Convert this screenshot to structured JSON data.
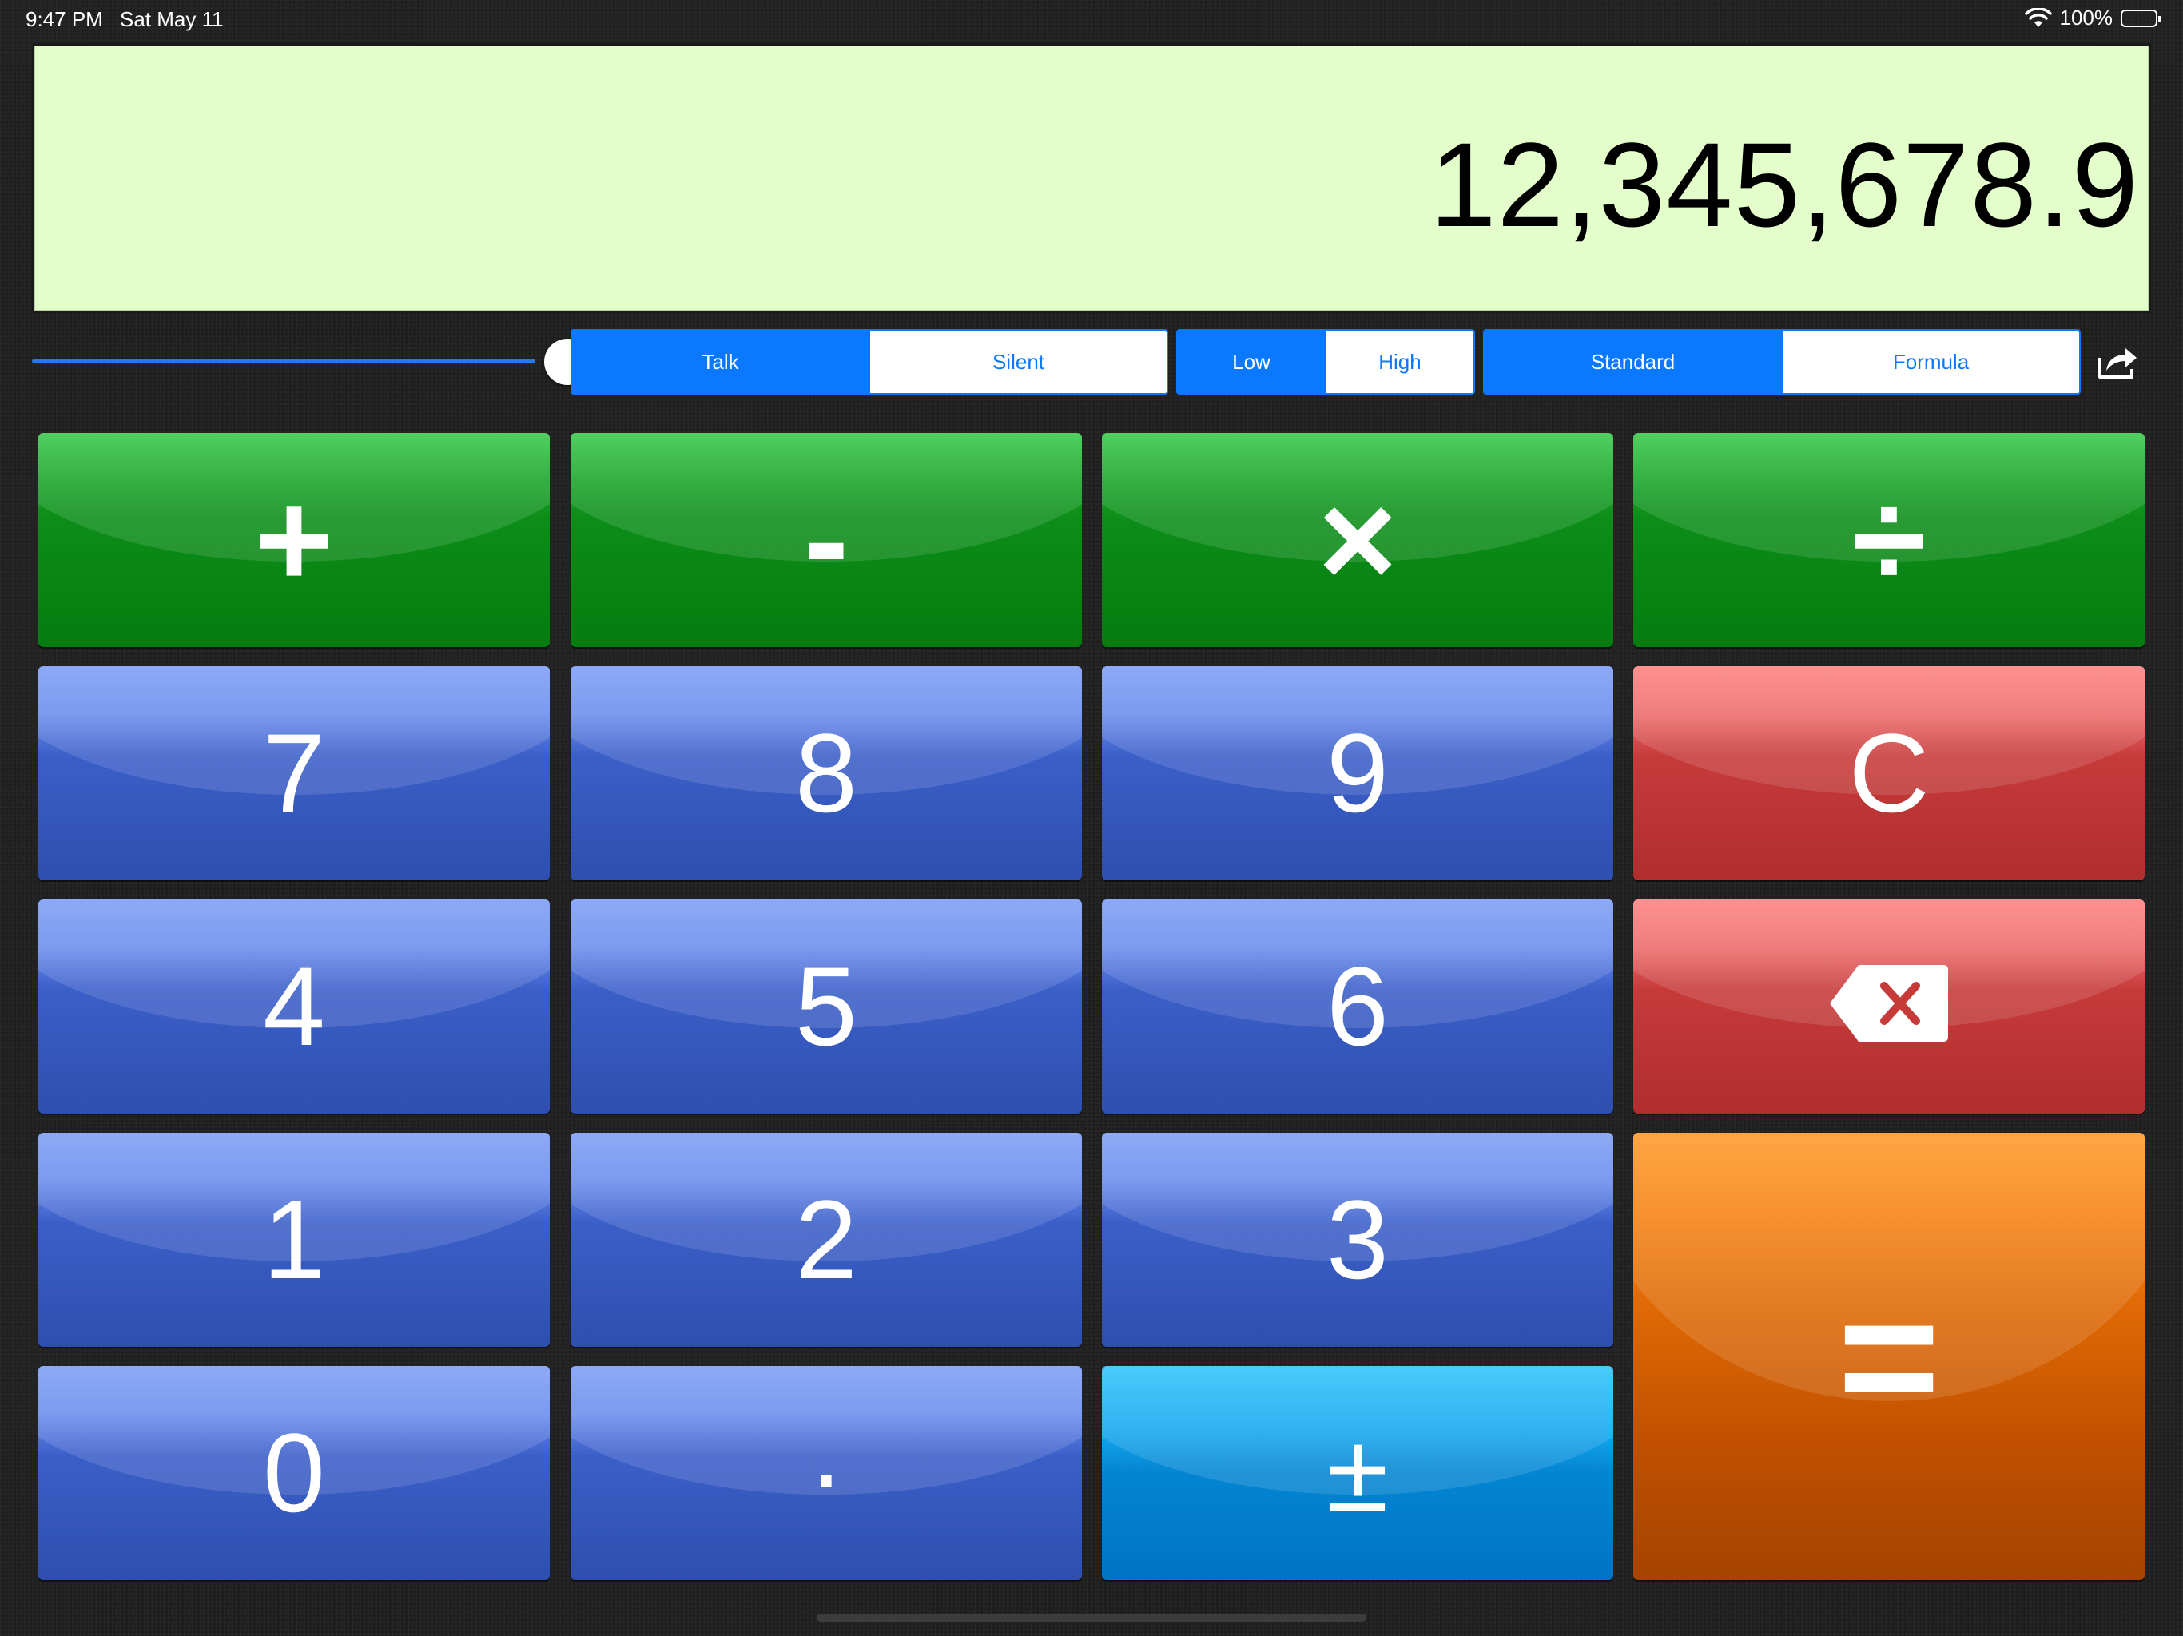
{
  "status_bar": {
    "time": "9:47 PM",
    "date": "Sat May 11",
    "battery": "100%",
    "icons": [
      "wifi-icon",
      "battery-icon"
    ]
  },
  "display": {
    "value": "12,345,678.9"
  },
  "controls": {
    "volume_slider": {
      "level": 1.0
    },
    "speech_mode": {
      "options": [
        "Talk",
        "Silent"
      ],
      "selected": "Talk"
    },
    "pitch": {
      "options": [
        "Low",
        "High"
      ],
      "selected": "Low"
    },
    "mode": {
      "options": [
        "Standard",
        "Formula"
      ],
      "selected": "Standard"
    },
    "share_icon": "share-icon"
  },
  "keys": {
    "plus": "+",
    "minus": "-",
    "multiply": "×",
    "divide": "÷",
    "seven": "7",
    "eight": "8",
    "nine": "9",
    "clear": "C",
    "four": "4",
    "five": "5",
    "six": "6",
    "backspace_icon": "backspace-icon",
    "one": "1",
    "two": "2",
    "three": "3",
    "equals": "=",
    "zero": "0",
    "decimal": "·",
    "plus_minus": "±"
  },
  "colors": {
    "operator_keys": "#0c8d18",
    "digit_keys": "#3b5fc9",
    "clear_keys": "#c73a3a",
    "equals_key": "#e06a05",
    "sign_key": "#0385d2",
    "segment_accent": "#0a78ff",
    "display_background": "#e3fdcb"
  }
}
